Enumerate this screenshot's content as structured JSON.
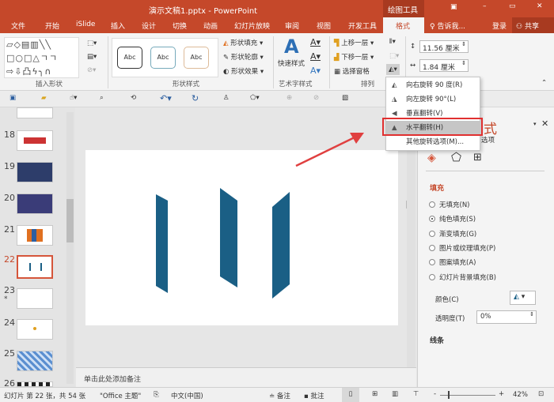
{
  "titlebar": {
    "title": "演示文稿1.pptx - PowerPoint",
    "context_tab": "绘图工具",
    "buttons": [
      "restore-ribbon",
      "minimize",
      "maximize",
      "close"
    ]
  },
  "tabs": [
    "文件",
    "开始",
    "iSlide",
    "插入",
    "设计",
    "切换",
    "动画",
    "幻灯片放映",
    "审阅",
    "视图",
    "开发工具",
    "格式"
  ],
  "active_tab": "格式",
  "tell_me": "告诉我...",
  "login": "登录",
  "share": "共享",
  "ribbon": {
    "groups": {
      "insert_shapes": "插入形状",
      "shape_styles": "形状样式",
      "wordart": "艺术字样式",
      "arrange": "排列"
    },
    "style_samples": [
      "Abc",
      "Abc",
      "Abc"
    ],
    "shape_fill": "形状填充",
    "shape_outline": "形状轮廓",
    "shape_effects": "形状效果",
    "quick_styles": "快速样式",
    "bring_forward": "上移一层",
    "send_backward": "下移一层",
    "selection_pane": "选择窗格",
    "height": "11.56 厘米",
    "width": "1.84 厘米"
  },
  "rotate_menu": {
    "items": [
      "向右旋转 90 度(R)",
      "向左旋转 90°(L)",
      "垂直翻转(V)",
      "水平翻转(H)",
      "其他旋转选项(M)..."
    ],
    "highlighted": "水平翻转(H)"
  },
  "thumbnails": [
    {
      "num": "18"
    },
    {
      "num": "19"
    },
    {
      "num": "20"
    },
    {
      "num": "21"
    },
    {
      "num": "22",
      "selected": true
    },
    {
      "num": "23",
      "star": "*"
    },
    {
      "num": "24"
    },
    {
      "num": "25"
    },
    {
      "num": "26"
    }
  ],
  "slide": {
    "shape_color": "#1a5f85"
  },
  "notes_placeholder": "单击此处添加备注",
  "format_pane": {
    "title_partial": "式",
    "subtitle_partial": "选项",
    "fill_header": "填充",
    "options": [
      "无填充(N)",
      "纯色填充(S)",
      "渐变填充(G)",
      "图片或纹理填充(P)",
      "图案填充(A)",
      "幻灯片背景填充(B)"
    ],
    "selected_option": "纯色填充(S)",
    "color_label": "颜色(C)",
    "transparency_label": "透明度(T)",
    "transparency_value": "0%",
    "line_header": "线条"
  },
  "status": {
    "slide_info": "幻灯片 第 22 张，共 54 张",
    "theme": "\"Office 主题\"",
    "language": "中文(中国)",
    "notes": "备注",
    "comments": "批注",
    "zoom": "42%",
    "zoom_minus": "-",
    "zoom_plus": "+"
  },
  "colors": {
    "accent": "#c5482a",
    "highlight_box": "#e03030",
    "arrow": "#e04040"
  }
}
